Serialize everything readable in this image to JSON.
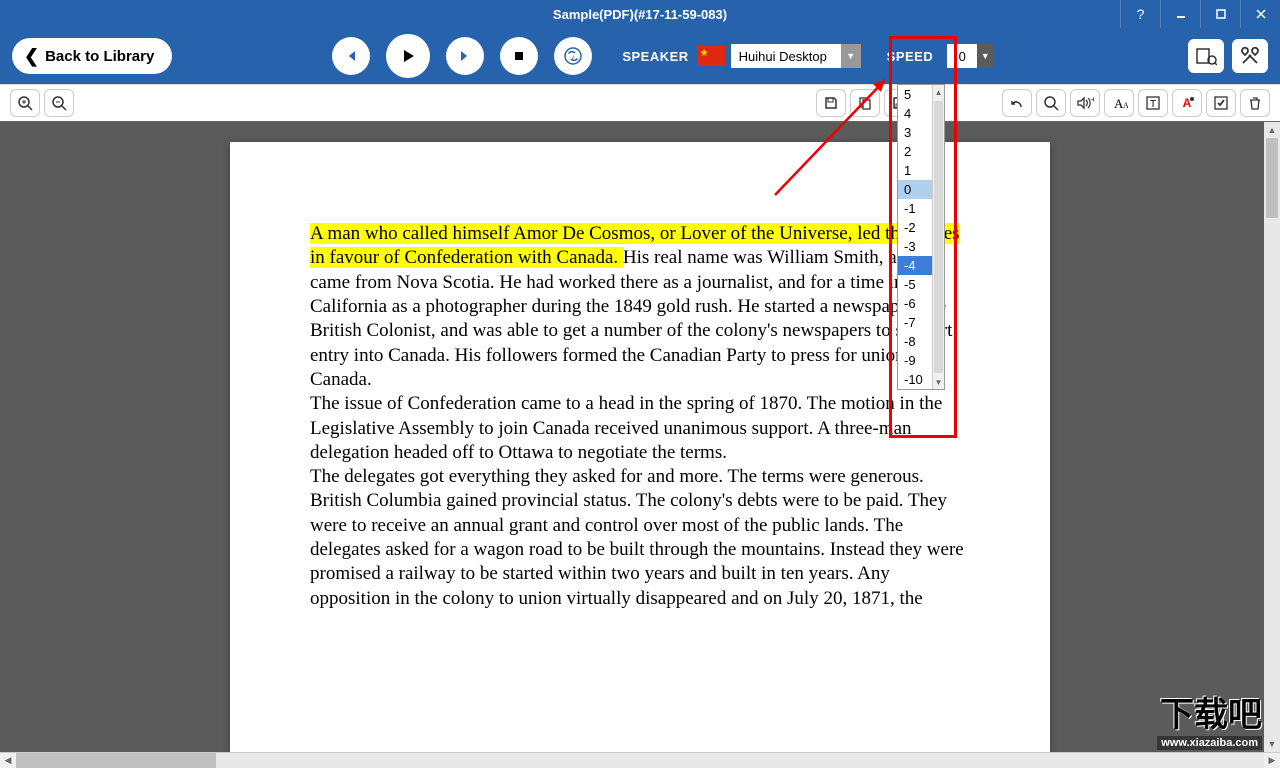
{
  "title": "Sample(PDF)(#17-11-59-083)",
  "toolbar": {
    "back_label": "Back to Library",
    "speaker_label": "SPEAKER",
    "speaker_value": "Huihui Desktop",
    "speed_label": "SPEED",
    "speed_value": "0"
  },
  "speed_options": [
    "5",
    "4",
    "3",
    "2",
    "1",
    "0",
    "-1",
    "-2",
    "-3",
    "-4",
    "-5",
    "-6",
    "-7",
    "-8",
    "-9",
    "-10"
  ],
  "speed_selected": "0",
  "speed_hover": "-4",
  "document": {
    "highlighted": "A man who called himself Amor De Cosmos, or Lover of the Universe, led the forces in favour of Confederation with Canada. ",
    "para1_rest": "His real name was William Smith, and he came from Nova Scotia. He had worked there as a journalist, and for a time in California as a photographer during the 1849 gold rush. He started a newspaper, the British Colonist, and was able to get a number of the colony's newspapers to support entry into Canada. His followers formed the Canadian Party to press for union with Canada.",
    "para2": "The issue of Confederation came to a head in the spring of 1870. The motion in the Legislative Assembly to join Canada received unanimous support. A three-man delegation headed off to Ottawa to negotiate the terms.",
    "para3": "The delegates got everything they asked for and more. The terms were generous. British Columbia gained provincial status. The colony's debts were to be paid. They were to receive an annual grant and control over most of the public lands. The delegates asked for a wagon road to be built through the mountains. Instead they were promised a railway to be started within two years and built in ten years. Any opposition in the colony to union virtually disappeared and on July 20, 1871, the"
  },
  "watermark": {
    "cn": "下载吧",
    "url": "www.xiazaiba.com"
  }
}
